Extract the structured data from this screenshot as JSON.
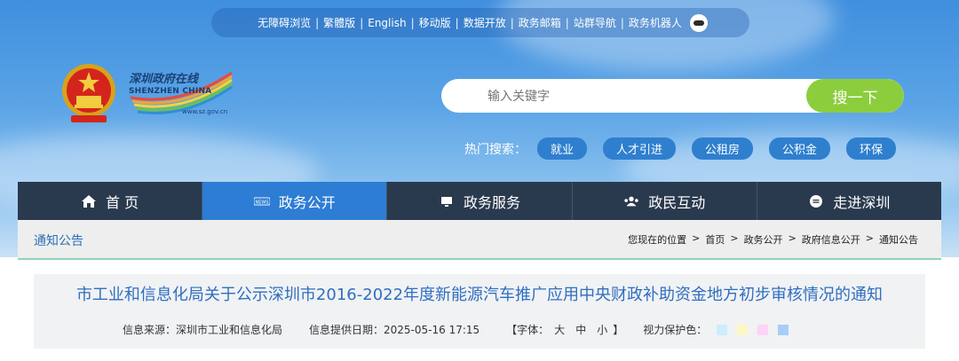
{
  "topbar": {
    "links": [
      "无障碍浏览",
      "繁體版",
      "English",
      "移动版",
      "数据开放",
      "政务邮箱",
      "站群导航",
      "政务机器人"
    ]
  },
  "logo": {
    "cn": "深圳政府在线",
    "en": "SHENZHEN CHINA",
    "url": "www.sz.gov.cn"
  },
  "search": {
    "placeholder": "输入关键字",
    "button": "搜一下"
  },
  "hot": {
    "label": "热门搜索：",
    "tags": [
      "就业",
      "人才引进",
      "公租房",
      "公积金",
      "环保"
    ]
  },
  "nav": [
    {
      "label": "首 页",
      "icon": "home-icon"
    },
    {
      "label": "政务公开",
      "icon": "news-icon"
    },
    {
      "label": "政务服务",
      "icon": "monitor-icon"
    },
    {
      "label": "政民互动",
      "icon": "people-icon"
    },
    {
      "label": "走进深圳",
      "icon": "info-icon"
    }
  ],
  "breadcrumb": {
    "category": "通知公告",
    "prefix": "您现在的位置",
    "items": [
      "首页",
      "政务公开",
      "政府信息公开",
      "通知公告"
    ]
  },
  "article": {
    "title": "市工业和信息化局关于公示深圳市2016-2022年度新能源汽车推广应用中央财政补助资金地方初步审核情况的通知",
    "source": "信息来源：深圳市工业和信息化局",
    "date": "信息提供日期：2025-05-16 17:15",
    "font_label": "【字体：",
    "font_large": "大",
    "font_medium": "中",
    "font_small": "小",
    "font_close": "】",
    "eye_label": "视力保护色：",
    "eye_colors": [
      "#cdeefd",
      "#fdf6c6",
      "#fbd4f8",
      "#a7cef8"
    ]
  },
  "colors": {
    "nav_bg": "#2a3a4e",
    "nav_active": "#2e7dd4",
    "search_button": "#8ccd3e",
    "title": "#2f6fc0"
  }
}
